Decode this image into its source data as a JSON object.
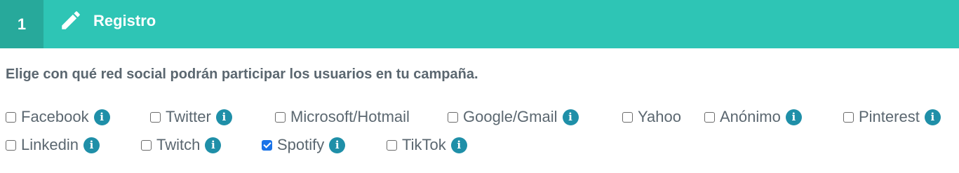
{
  "header": {
    "step_number": "1",
    "title": "Registro",
    "icon": "pencil-icon",
    "bg_color": "#2ec5b5",
    "step_bg_color": "#27a99b"
  },
  "prompt": "Elige con qué red social podrán participar los usuarios en tu campaña.",
  "info_glyph": "i",
  "options": [
    {
      "label": "Facebook",
      "checked": false,
      "has_info": true
    },
    {
      "label": "Twitter",
      "checked": false,
      "has_info": true
    },
    {
      "label": "Microsoft/Hotmail",
      "checked": false,
      "has_info": false
    },
    {
      "label": "Google/Gmail",
      "checked": false,
      "has_info": true
    },
    {
      "label": "Yahoo",
      "checked": false,
      "has_info": false
    },
    {
      "label": "Anónimo",
      "checked": false,
      "has_info": true
    },
    {
      "label": "Pinterest",
      "checked": false,
      "has_info": true
    },
    {
      "label": "Linkedin",
      "checked": false,
      "has_info": true
    },
    {
      "label": "Twitch",
      "checked": false,
      "has_info": true
    },
    {
      "label": "Spotify",
      "checked": true,
      "has_info": true
    },
    {
      "label": "TikTok",
      "checked": false,
      "has_info": true
    }
  ]
}
